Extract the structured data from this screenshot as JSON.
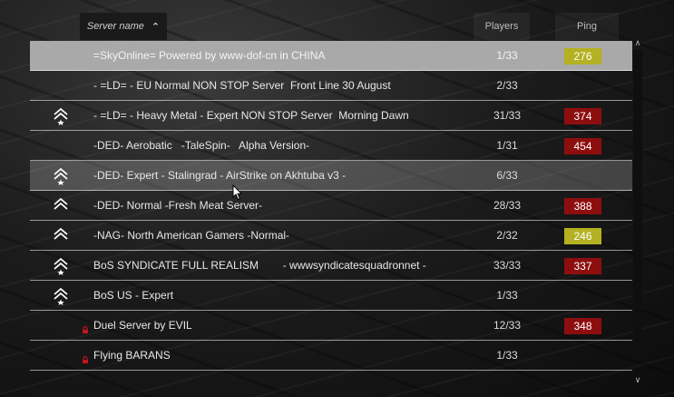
{
  "header": {
    "server_name_label": "Server name",
    "players_label": "Players",
    "ping_label": "Ping"
  },
  "colors": {
    "ping_yellow": "#b4b122",
    "ping_red": "#8d0e0e",
    "selected_row": "#a9a9a9"
  },
  "servers": [
    {
      "name": "=SkyOnline= Powered by www-dof-cn in CHINA",
      "players": "1/33",
      "ping": "276",
      "ping_color": "yellow",
      "icon": "none",
      "state": "selected"
    },
    {
      "name": "- =LD= - EU Normal NON STOP Server  Front Line 30 August",
      "players": "2/33",
      "ping": "",
      "ping_color": "none",
      "icon": "none",
      "state": ""
    },
    {
      "name": "- =LD= - Heavy Metal - Expert NON STOP Server  Morning Dawn",
      "players": "31/33",
      "ping": "374",
      "ping_color": "red",
      "icon": "rank-star",
      "state": ""
    },
    {
      "name": "-DED- Aerobatic   -TaleSpin-   Alpha Version-",
      "players": "1/31",
      "ping": "454",
      "ping_color": "red",
      "icon": "none",
      "state": ""
    },
    {
      "name": "-DED- Expert - Stalingrad - AirStrike on Akhtuba v3 -",
      "players": "6/33",
      "ping": "",
      "ping_color": "none",
      "icon": "rank-star",
      "state": "hover"
    },
    {
      "name": "-DED- Normal -Fresh Meat Server-",
      "players": "28/33",
      "ping": "388",
      "ping_color": "red",
      "icon": "rank",
      "state": ""
    },
    {
      "name": "-NAG- North American Gamers -Normal-",
      "players": "2/32",
      "ping": "246",
      "ping_color": "yellow",
      "icon": "rank",
      "state": ""
    },
    {
      "name": "BoS SYNDICATE FULL REALISM        - wwwsyndicatesquadronnet -",
      "players": "33/33",
      "ping": "337",
      "ping_color": "red",
      "icon": "rank-star",
      "state": ""
    },
    {
      "name": "BoS US - Expert",
      "players": "1/33",
      "ping": "",
      "ping_color": "none",
      "icon": "rank-star",
      "state": ""
    },
    {
      "name": "Duel Server by EVIL",
      "players": "12/33",
      "ping": "348",
      "ping_color": "red",
      "icon": "lock",
      "state": ""
    },
    {
      "name": "Flying BARANS",
      "players": "1/33",
      "ping": "",
      "ping_color": "none",
      "icon": "lock",
      "state": ""
    }
  ]
}
